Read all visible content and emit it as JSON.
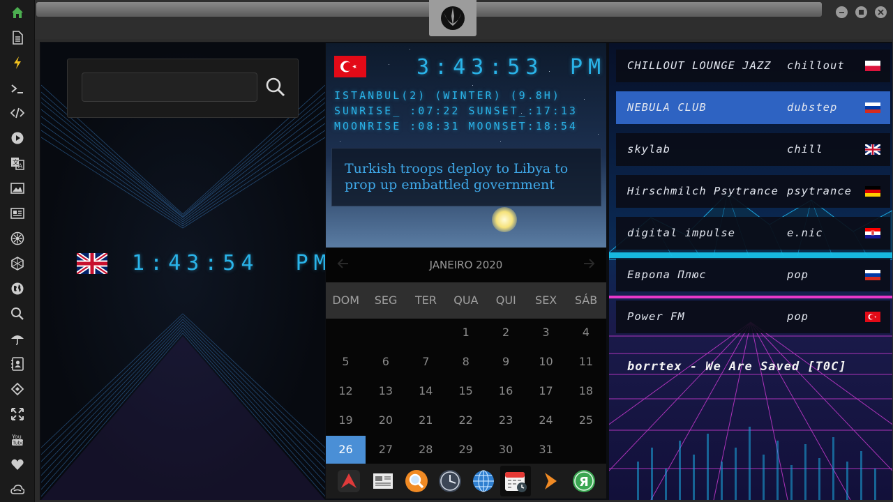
{
  "rail": {
    "icons": [
      "home-icon",
      "document-icon",
      "lightning-icon",
      "terminal-icon",
      "code-icon",
      "play-icon",
      "translate-icon",
      "image-icon",
      "news-icon",
      "settings-wheel-icon",
      "hexagon-icon",
      "globe-icon",
      "search-icon",
      "umbrella-icon",
      "contact-card-icon",
      "tag-icon",
      "expand-icon",
      "youtube-icon",
      "heart-icon",
      "cloud-icon"
    ],
    "youtube_label": "You\nTube"
  },
  "colors": {
    "accent": "#2ab3e8",
    "selected_station": "#2e63c2",
    "today": "#4a8fd6"
  },
  "local_clock": {
    "flag": "uk-flag",
    "time": "1:43:54",
    "ampm": "PM"
  },
  "world_clock": {
    "flag": "turkey-flag",
    "time": "3:43:53",
    "ampm": "PM",
    "line1": "ISTANBUL(2) (WINTER) (9.8H)",
    "line2": "SUNRISE_ :07:22 SUNSET_:17:13",
    "line3": "MOONRISE :08:31 MOONSET:18:54"
  },
  "news": {
    "headline": "Turkish troops deploy to Libya to prop up embattled government"
  },
  "search": {
    "placeholder": "",
    "value": ""
  },
  "calendar": {
    "title": "JANEIRO 2020",
    "weekdays": [
      "DOM",
      "SEG",
      "TER",
      "QUA",
      "QUI",
      "SEX",
      "SÁB"
    ],
    "days": [
      "1",
      "2",
      "3",
      "4",
      "5",
      "6",
      "7",
      "8",
      "9",
      "10",
      "11",
      "12",
      "13",
      "14",
      "15",
      "16",
      "17",
      "18",
      "19",
      "20",
      "21",
      "22",
      "23",
      "24",
      "25",
      "26",
      "27",
      "28",
      "29",
      "30",
      "31"
    ],
    "first_weekday_index": 3,
    "today": "26"
  },
  "dock": {
    "apps": [
      "red-triangle-app-icon",
      "newspaper-app-icon",
      "magnifier-app-icon",
      "clock-app-icon",
      "globe-app-icon",
      "calendar-app-icon",
      "arrow-app-icon",
      "yandex-app-icon"
    ],
    "active": "calendar-app-icon"
  },
  "radio": {
    "stations": [
      {
        "name": "CHILLOUT LOUNGE JAZZ",
        "genre": "chillout",
        "flag": "poland-flag"
      },
      {
        "name": "NEBULA CLUB",
        "genre": "dubstep",
        "flag": "russia-flag"
      },
      {
        "name": "skylab",
        "genre": "chill",
        "flag": "uk-flag"
      },
      {
        "name": "Hirschmilch Psytrance",
        "genre": "psytrance",
        "flag": "germany-flag"
      },
      {
        "name": "digital impulse",
        "genre": "e.nic",
        "flag": "croatia-flag"
      },
      {
        "name": "Европа Плюс",
        "genre": "pop",
        "flag": "russia-flag"
      },
      {
        "name": "Power FM",
        "genre": "pop",
        "flag": "turkey-flag"
      }
    ],
    "selected": "NEBULA CLUB",
    "now_playing": "borrtex - We Are Saved [T0C]"
  }
}
